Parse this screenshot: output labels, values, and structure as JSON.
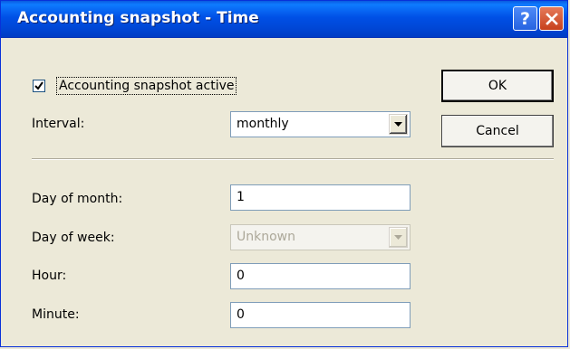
{
  "window": {
    "title": "Accounting snapshot - Time",
    "help_label": "?",
    "close_icon": "close-icon"
  },
  "form": {
    "active": {
      "label": "Accounting snapshot active",
      "checked": true
    },
    "interval": {
      "label": "Interval:",
      "value": "monthly"
    },
    "day_of_month": {
      "label": "Day of month:",
      "value": "1"
    },
    "day_of_week": {
      "label": "Day of week:",
      "value": "Unknown",
      "disabled": true
    },
    "hour": {
      "label": "Hour:",
      "value": "0"
    },
    "minute": {
      "label": "Minute:",
      "value": "0"
    }
  },
  "buttons": {
    "ok": "OK",
    "cancel": "Cancel"
  },
  "colors": {
    "titlebar": "#0054E3",
    "face": "#ECE9D8",
    "close_button": "#C7401C",
    "disabled_text": "#ACA899"
  }
}
